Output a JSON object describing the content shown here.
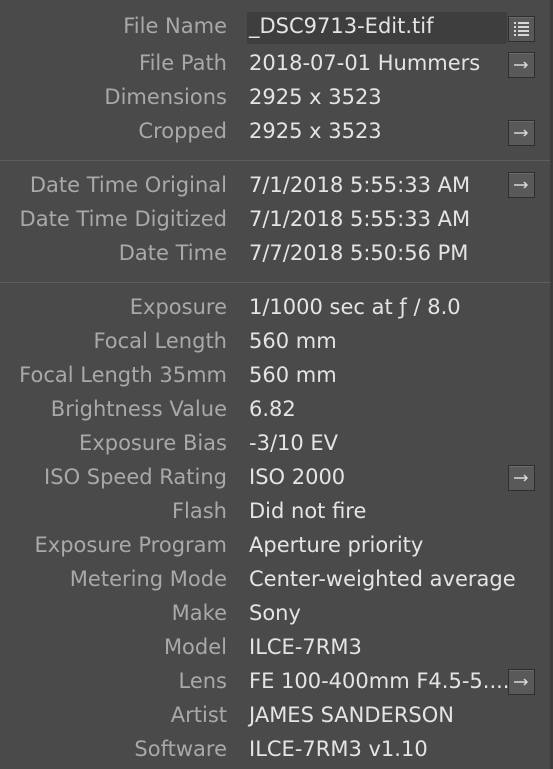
{
  "metadata_panel": {
    "file_name": {
      "label": "File Name",
      "value": "_DSC9713-Edit.tif",
      "icon": "list-icon"
    },
    "file_path": {
      "label": "File Path",
      "value": "2018-07-01 Hummers",
      "icon": "arrow-right-icon"
    },
    "dimensions": {
      "label": "Dimensions",
      "value": "2925 x 3523"
    },
    "cropped": {
      "label": "Cropped",
      "value": "2925 x 3523",
      "icon": "arrow-right-icon"
    },
    "date_time_original": {
      "label": "Date Time Original",
      "value": "7/1/2018 5:55:33 AM",
      "icon": "arrow-right-icon"
    },
    "date_time_digitized": {
      "label": "Date Time Digitized",
      "value": "7/1/2018 5:55:33 AM"
    },
    "date_time": {
      "label": "Date Time",
      "value": "7/7/2018 5:50:56 PM"
    },
    "exposure": {
      "label": "Exposure",
      "value": "1/1000 sec at ƒ / 8.0"
    },
    "focal_length": {
      "label": "Focal Length",
      "value": "560 mm"
    },
    "focal_length_35mm": {
      "label": "Focal Length 35mm",
      "value": "560 mm"
    },
    "brightness_value": {
      "label": "Brightness Value",
      "value": "6.82"
    },
    "exposure_bias": {
      "label": "Exposure Bias",
      "value": "-3/10 EV"
    },
    "iso_speed_rating": {
      "label": "ISO Speed Rating",
      "value": "ISO 2000",
      "icon": "arrow-right-icon"
    },
    "flash": {
      "label": "Flash",
      "value": "Did not fire"
    },
    "exposure_program": {
      "label": "Exposure Program",
      "value": "Aperture priority"
    },
    "metering_mode": {
      "label": "Metering Mode",
      "value": "Center-weighted average"
    },
    "make": {
      "label": "Make",
      "value": "Sony"
    },
    "model": {
      "label": "Model",
      "value": "ILCE-7RM3"
    },
    "lens": {
      "label": "Lens",
      "value": "FE 100-400mm F4.5-5....",
      "icon": "arrow-right-icon"
    },
    "artist": {
      "label": "Artist",
      "value": "JAMES SANDERSON"
    },
    "software": {
      "label": "Software",
      "value": "ILCE-7RM3 v1.10"
    }
  },
  "colors": {
    "panel_background": "#4a4a4a",
    "label_text": "#a9a9a9",
    "value_text": "#e4e4e4",
    "divider": "#5e5e5e",
    "button_background": "#595959"
  }
}
